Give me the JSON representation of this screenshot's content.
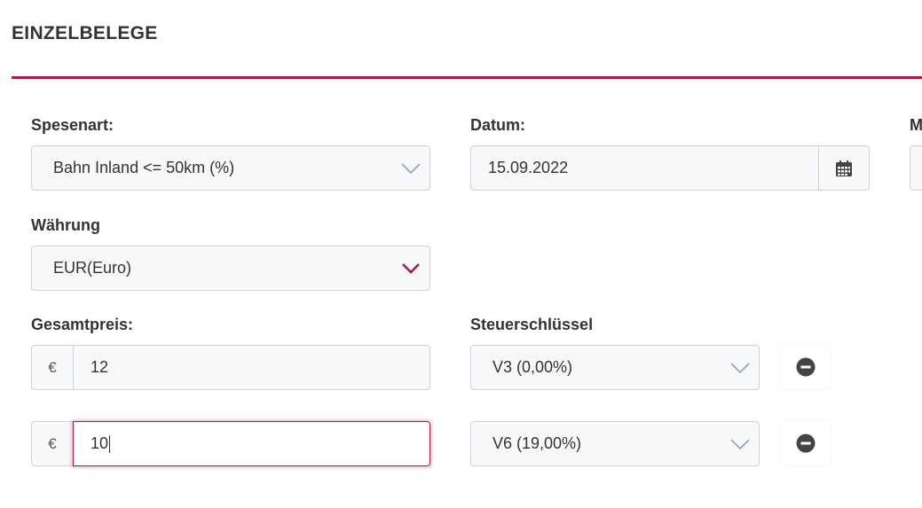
{
  "section": {
    "title": "EINZELBELEGE"
  },
  "colors": {
    "accent": "#b0184a",
    "field_bg": "#f7f8fa",
    "border": "#cfd3d8"
  },
  "spesenart": {
    "label": "Spesenart:",
    "value": "Bahn Inland <= 50km (%)"
  },
  "datum": {
    "label": "Datum:",
    "value": "15.09.2022",
    "icon": "calendar-icon"
  },
  "cut_off": {
    "label": "M"
  },
  "waehrung": {
    "label": "Währung",
    "value": "EUR(Euro)"
  },
  "gesamtpreis": {
    "label": "Gesamtpreis:"
  },
  "steuerschluessel": {
    "label": "Steuerschlüssel"
  },
  "lines": [
    {
      "currency": "€",
      "amount": "12",
      "tax": "V3 (0,00%)",
      "remove_icon": "minus-circle-icon"
    },
    {
      "currency": "€",
      "amount": "10",
      "tax": "V6 (19,00%)",
      "remove_icon": "minus-circle-icon"
    }
  ]
}
